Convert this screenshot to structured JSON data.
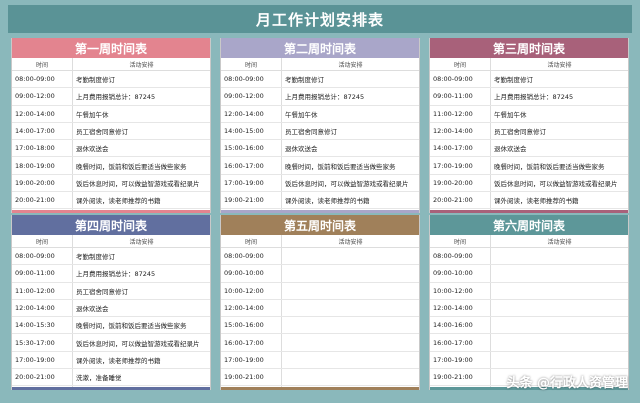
{
  "page": {
    "title": "月工作计划安排表",
    "col_time": "时间",
    "col_activity": "活动安排"
  },
  "weeks": [
    {
      "name": "第一周时间表",
      "color": "#e3848f",
      "rows": [
        {
          "time": "08:00-09:00",
          "activity": "考勤制度修订"
        },
        {
          "time": "09:00-12:00",
          "activity": "上月费用报销总计：87245"
        },
        {
          "time": "12:00-14:00",
          "activity": "午餐加午休"
        },
        {
          "time": "14:00-17:00",
          "activity": "员工宿舍同意修订"
        },
        {
          "time": "17:00-18:00",
          "activity": "退休欢送会"
        },
        {
          "time": "18:00-19:00",
          "activity": "晚餐时间，饭前和饭后要适当做些家务"
        },
        {
          "time": "19:00-20:00",
          "activity": "饭后休息时间，可以做益智游戏或看纪录片"
        },
        {
          "time": "20:00-21:00",
          "activity": "课外阅读，读老师推荐的书籍"
        },
        {
          "time": "21:00-22:00",
          "activity": "洗漱，准备睡觉"
        }
      ]
    },
    {
      "name": "第二周时间表",
      "color": "#a9a6c9",
      "rows": [
        {
          "time": "08:00-09:00",
          "activity": "考勤制度修订"
        },
        {
          "time": "09:00-12:00",
          "activity": "上月费用报销总计：87245"
        },
        {
          "time": "12:00-14:00",
          "activity": "午餐加午休"
        },
        {
          "time": "14:00-15:00",
          "activity": "员工宿舍同意修订"
        },
        {
          "time": "15:00-16:00",
          "activity": "退休欢送会"
        },
        {
          "time": "16:00-17:00",
          "activity": "晚餐时间，饭前和饭后要适当做些家务"
        },
        {
          "time": "17:00-19:00",
          "activity": "饭后休息时间，可以做益智游戏或看纪录片"
        },
        {
          "time": "19:00-21:00",
          "activity": "课外阅读，读老师推荐的书籍"
        },
        {
          "time": "21:00-22:00",
          "activity": "洗漱，准备睡觉"
        }
      ]
    },
    {
      "name": "第三周时间表",
      "color": "#a8617a",
      "rows": [
        {
          "time": "08:00-09:00",
          "activity": "考勤制度修订"
        },
        {
          "time": "09:00-11:00",
          "activity": "上月费用报销总计：87245"
        },
        {
          "time": "11:00-12:00",
          "activity": "午餐加午休"
        },
        {
          "time": "12:00-14:00",
          "activity": "员工宿舍同意修订"
        },
        {
          "time": "14:00-17:00",
          "activity": "退休欢送会"
        },
        {
          "time": "17:00-19:00",
          "activity": "晚餐时间，饭前和饭后要适当做些家务"
        },
        {
          "time": "19:00-20:00",
          "activity": "饭后休息时间，可以做益智游戏或看纪录片"
        },
        {
          "time": "20:00-21:00",
          "activity": "课外阅读，读老师推荐的书籍"
        },
        {
          "time": "21:00-22:00",
          "activity": "洗漱，准备睡觉"
        }
      ]
    },
    {
      "name": "第四周时间表",
      "color": "#616f9f",
      "rows": [
        {
          "time": "08:00-09:00",
          "activity": "考勤制度修订"
        },
        {
          "time": "09:00-11:00",
          "activity": "上月费用报销总计：87245"
        },
        {
          "time": "11:00-12:00",
          "activity": "员工宿舍同意修订"
        },
        {
          "time": "12:00-14:00",
          "activity": "退休欢送会"
        },
        {
          "time": "14:00-15:30",
          "activity": "晚餐时间，饭前和饭后要适当做些家务"
        },
        {
          "time": "15:30-17:00",
          "activity": "饭后休息时间，可以做益智游戏或看纪录片"
        },
        {
          "time": "17:00-19:00",
          "activity": "课外阅读，读老师推荐的书籍"
        },
        {
          "time": "20:00-21:00",
          "activity": "洗漱，准备睡觉"
        },
        {
          "time": "21:00-22:00",
          "activity": "洗漱，准备睡觉"
        }
      ]
    },
    {
      "name": "第五周时间表",
      "color": "#a0805a",
      "rows": [
        {
          "time": "08:00-09:00",
          "activity": ""
        },
        {
          "time": "09:00-10:00",
          "activity": ""
        },
        {
          "time": "10:00-12:00",
          "activity": ""
        },
        {
          "time": "12:00-14:00",
          "activity": ""
        },
        {
          "time": "15:00-16:00",
          "activity": ""
        },
        {
          "time": "16:00-17:00",
          "activity": ""
        },
        {
          "time": "17:00-19:00",
          "activity": ""
        },
        {
          "time": "19:00-21:00",
          "activity": ""
        },
        {
          "time": "21:00-22:00",
          "activity": ""
        }
      ]
    },
    {
      "name": "第六周时间表",
      "color": "#5d9799",
      "rows": [
        {
          "time": "08:00-09:00",
          "activity": ""
        },
        {
          "time": "09:00-10:00",
          "activity": ""
        },
        {
          "time": "10:00-12:00",
          "activity": ""
        },
        {
          "time": "12:00-14:00",
          "activity": ""
        },
        {
          "time": "14:00-16:00",
          "activity": ""
        },
        {
          "time": "16:00-17:00",
          "activity": ""
        },
        {
          "time": "17:00-19:00",
          "activity": ""
        },
        {
          "time": "19:00-21:00",
          "activity": ""
        },
        {
          "time": "21:00-22:00",
          "activity": ""
        }
      ]
    }
  ],
  "watermark": "头条 @行政人资管理"
}
